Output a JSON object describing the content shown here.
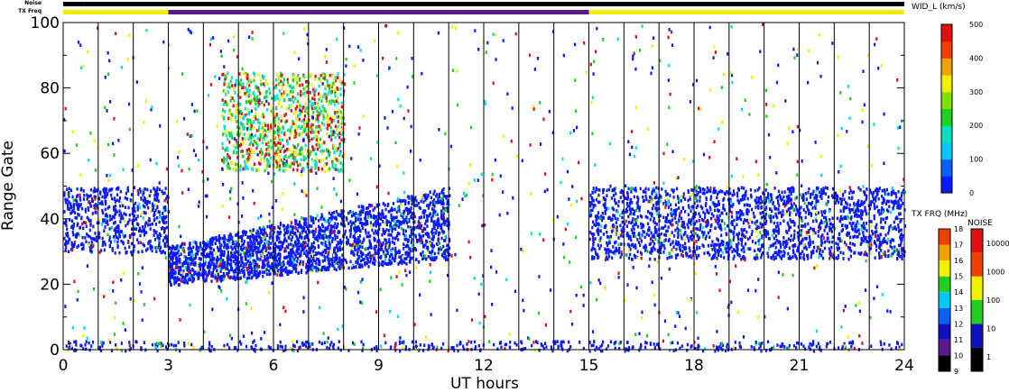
{
  "chart_data": {
    "type": "heatmap",
    "xlabel": "UT hours",
    "ylabel": "Range Gate",
    "xlim": [
      0,
      24
    ],
    "ylim": [
      0,
      100
    ],
    "x_ticks": [
      "0",
      "3",
      "6",
      "9",
      "12",
      "15",
      "18",
      "21",
      "24"
    ],
    "y_ticks": [
      "0",
      "20",
      "40",
      "60",
      "80",
      "100"
    ],
    "scan_boundaries_hours": [
      1,
      2,
      3,
      4,
      5,
      6,
      7,
      8,
      9,
      10,
      11,
      12,
      13,
      14,
      15,
      16,
      17,
      18,
      19,
      20,
      21,
      22,
      23
    ],
    "top_strips": {
      "noise_label": "Noise",
      "txfreq_label": "TX Freq",
      "noise_segments": [
        {
          "start": 0,
          "end": 0.6,
          "color": "#000000"
        },
        {
          "start": 0.6,
          "end": 24,
          "color": "#000000"
        }
      ],
      "txfreq_segments": [
        {
          "start": 0,
          "end": 3,
          "color": "#f0f000"
        },
        {
          "start": 3,
          "end": 15,
          "color": "#5a1a8a"
        },
        {
          "start": 15,
          "end": 24,
          "color": "#f0f000"
        }
      ]
    },
    "echo_bands": [
      {
        "name": "ground scatter near-range",
        "t_start": 0,
        "t_end": 24,
        "g_min": 0,
        "g_max": 3
      },
      {
        "name": "main band early",
        "t_start": 0,
        "t_end": 3,
        "g_min": 30,
        "g_max": 50
      },
      {
        "name": "main band rising",
        "t_start": 3,
        "t_end": 11,
        "g_min": 20,
        "g_max": 50
      },
      {
        "name": "main band late",
        "t_start": 15,
        "t_end": 24,
        "g_min": 28,
        "g_max": 50
      },
      {
        "name": "high wide echoes",
        "t_start": 4.5,
        "t_end": 8,
        "g_min": 55,
        "g_max": 85
      }
    ],
    "colorbar_width": {
      "title": "WID_L (km/s)",
      "ticks": [
        "0",
        "100",
        "200",
        "300",
        "400",
        "500"
      ],
      "range": [
        0,
        500
      ]
    },
    "colorbar_txfreq": {
      "title": "TX FRQ (MHz)",
      "ticks": [
        "9",
        "10",
        "11",
        "12",
        "13",
        "14",
        "15",
        "16",
        "17",
        "18"
      ]
    },
    "colorbar_noise": {
      "title": "NOISE",
      "ticks": [
        "1",
        "10",
        "100",
        "1000",
        "10000"
      ]
    },
    "colors": {
      "background": "#ffffff",
      "low": "#0a1aff",
      "mid": "#00e0e0",
      "green": "#20d020",
      "yellow": "#f0f000",
      "red": "#e01010"
    }
  }
}
